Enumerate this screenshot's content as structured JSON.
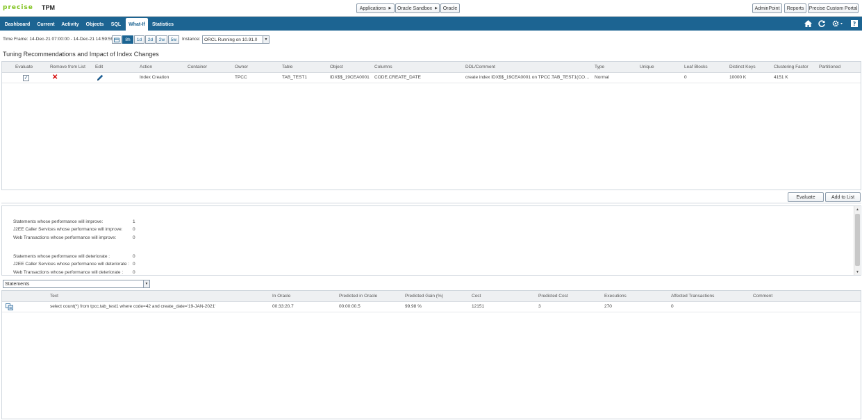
{
  "header": {
    "logo_text": "precise",
    "product": "TPM",
    "breadcrumbs": [
      {
        "label": "Applications"
      },
      {
        "label": "Oracle Sandbox"
      },
      {
        "label": "Oracle"
      }
    ],
    "right_buttons": {
      "adminpoint": "AdminPoint",
      "reports": "Reports",
      "portal": "Precise Custom Portal"
    }
  },
  "nav": {
    "tabs": [
      "Dashboard",
      "Current",
      "Activity",
      "Objects",
      "SQL",
      "What-If",
      "Statistics"
    ],
    "active_tab": "What-If",
    "icons": [
      "home-icon",
      "refresh-icon",
      "gear-icon",
      "help-icon"
    ]
  },
  "timeframe": {
    "label": "Time Frame: 14-Dec-21 07:00:00 - 14-Dec-21 14:59:59",
    "ranges": [
      "8h",
      "1d",
      "2d",
      "2w",
      "5w"
    ],
    "active_range": "8h",
    "instance_label": "Instance:",
    "instance_value": "ORCL Running on 10.91.0"
  },
  "recommendations": {
    "title": "Tuning Recommendations and Impact of Index Changes",
    "columns": {
      "evaluate": "Evaluate",
      "remove": "Remove from List",
      "edit": "Edit",
      "action": "Action",
      "container": "Container",
      "owner": "Owner",
      "table": "Table",
      "object": "Object",
      "columns": "Columns",
      "ddl": "DDL/Comment",
      "type": "Type",
      "unique": "Unique",
      "leaf_blocks": "Leaf Blocks",
      "distinct_keys": "Distinct Keys",
      "clustering_factor": "Clustering Factor",
      "partitioned": "Partitioned"
    },
    "rows": [
      {
        "evaluate": true,
        "action": "Index Creation",
        "container": "",
        "owner": "TPCC",
        "table": "TAB_TEST1",
        "object": "IDX$$_19CEA0001",
        "columns": "CODE,CREATE_DATE",
        "ddl": "create index IDX$$_19CEA0001 on TPCC.TAB_TEST1(CODE...",
        "type": "Normal",
        "unique": "",
        "leaf_blocks": "0",
        "distinct_keys": "10000 K",
        "clustering_factor": "4151 K",
        "partitioned": ""
      }
    ],
    "buttons": {
      "evaluate": "Evaluate",
      "add_to_list": "Add to List"
    }
  },
  "summary": {
    "improve": [
      {
        "label": "Statements whose performance will improve:",
        "value": "1"
      },
      {
        "label": "J2EE Caller Services whose performance will improve:",
        "value": "0"
      },
      {
        "label": "Web Transactions whose performance will improve:",
        "value": "0"
      }
    ],
    "deteriorate": [
      {
        "label": "Statements whose performance will deteriorate :",
        "value": "0"
      },
      {
        "label": "J2EE Caller Services whose performance will deteriorate :",
        "value": "0"
      },
      {
        "label": "Web Transactions whose performance will deteriorate :",
        "value": "0"
      }
    ]
  },
  "statements": {
    "selector": "Statements",
    "columns": {
      "text": "Text",
      "in_oracle": "In Oracle",
      "predicted_in_oracle": "Predicted in Oracle",
      "predicted_gain": "Predicted Gain (%)",
      "cost": "Cost",
      "predicted_cost": "Predicted Cost",
      "executions": "Executions",
      "affected_transactions": "Affected Transactions",
      "comment": "Comment"
    },
    "rows": [
      {
        "text": "select count(*) from tpcc.tab_test1 where code=42 and create_date='19-JAN-2021'",
        "in_oracle": "00:33:20.7",
        "predicted_in_oracle": "00:00:00.5",
        "predicted_gain": "99.98 %",
        "cost": "12151",
        "predicted_cost": "3",
        "executions": "270",
        "affected_transactions": "0",
        "comment": ""
      }
    ]
  },
  "colors": {
    "brand_green": "#7fc31c",
    "nav_blue": "#1c6492",
    "remove_red": "#d40000"
  }
}
